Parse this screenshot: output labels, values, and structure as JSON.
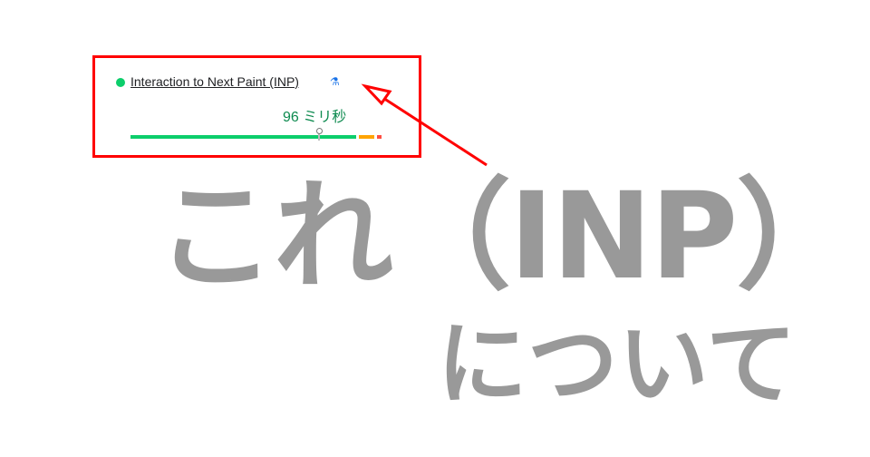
{
  "metric": {
    "status_color": "#0cce6b",
    "title": "Interaction to Next Paint (INP)",
    "lab_icon": "flask-icon",
    "value": "96 ミリ秒",
    "value_color": "#0d8a4f",
    "distribution": {
      "good_color": "#0cce6b",
      "needs_improvement_color": "#ffa400",
      "poor_color": "#ff4e42"
    }
  },
  "annotation": {
    "highlight_color": "#ff0000",
    "heading_line1": "これ（INP）",
    "heading_line2": "について",
    "heading_color": "#999999"
  }
}
